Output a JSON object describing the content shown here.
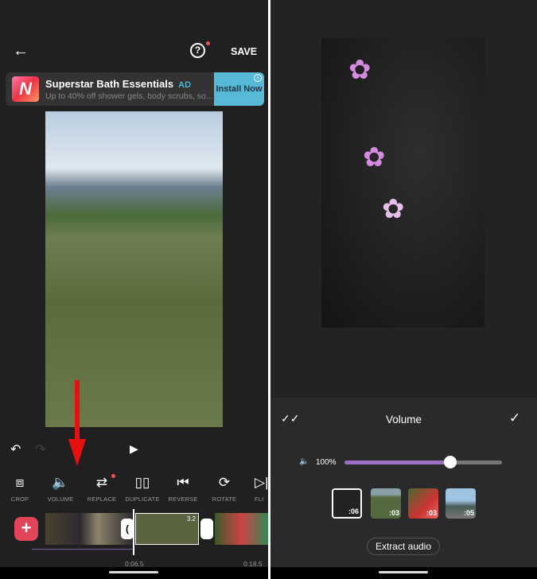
{
  "left": {
    "header": {
      "back_icon": "arrow-left-icon",
      "help_icon": "help-circle-icon",
      "save_label": "SAVE"
    },
    "ad": {
      "logo_letter": "N",
      "title": "Superstar Bath Essentials",
      "badge": "AD",
      "subtitle": "Up to 40% off shower gels, body scrubs, so...",
      "cta": "Install Now",
      "info_icon": "i"
    },
    "playback": {
      "undo_icon": "undo-icon",
      "redo_icon": "redo-icon",
      "play_icon": "play-icon"
    },
    "tools": [
      {
        "label": "CROP",
        "icon": "crop-icon"
      },
      {
        "label": "VOLUME",
        "icon": "volume-icon"
      },
      {
        "label": "REPLACE",
        "icon": "replace-icon"
      },
      {
        "label": "DUPLICATE",
        "icon": "duplicate-icon"
      },
      {
        "label": "REVERSE",
        "icon": "reverse-icon"
      },
      {
        "label": "ROTATE",
        "icon": "rotate-icon"
      },
      {
        "label": "FLI",
        "icon": "flip-icon"
      }
    ],
    "timeline": {
      "add_label": "+",
      "selected_clip_duration": "3.2",
      "current_time": "0:06.5",
      "total_time": "0:18.5"
    },
    "annotation_color": "#e8100f"
  },
  "right": {
    "sheet": {
      "apply_all_icon": "double-check-icon",
      "title": "Volume",
      "confirm_icon": "check-icon",
      "volume_value": "100%",
      "slider_fill": 0.67,
      "accent": "#9b6fc4",
      "clips": [
        {
          "duration": ":06",
          "selected": true
        },
        {
          "duration": ":03"
        },
        {
          "duration": ":03"
        },
        {
          "duration": ":05"
        }
      ],
      "extract_label": "Extract audio"
    }
  }
}
